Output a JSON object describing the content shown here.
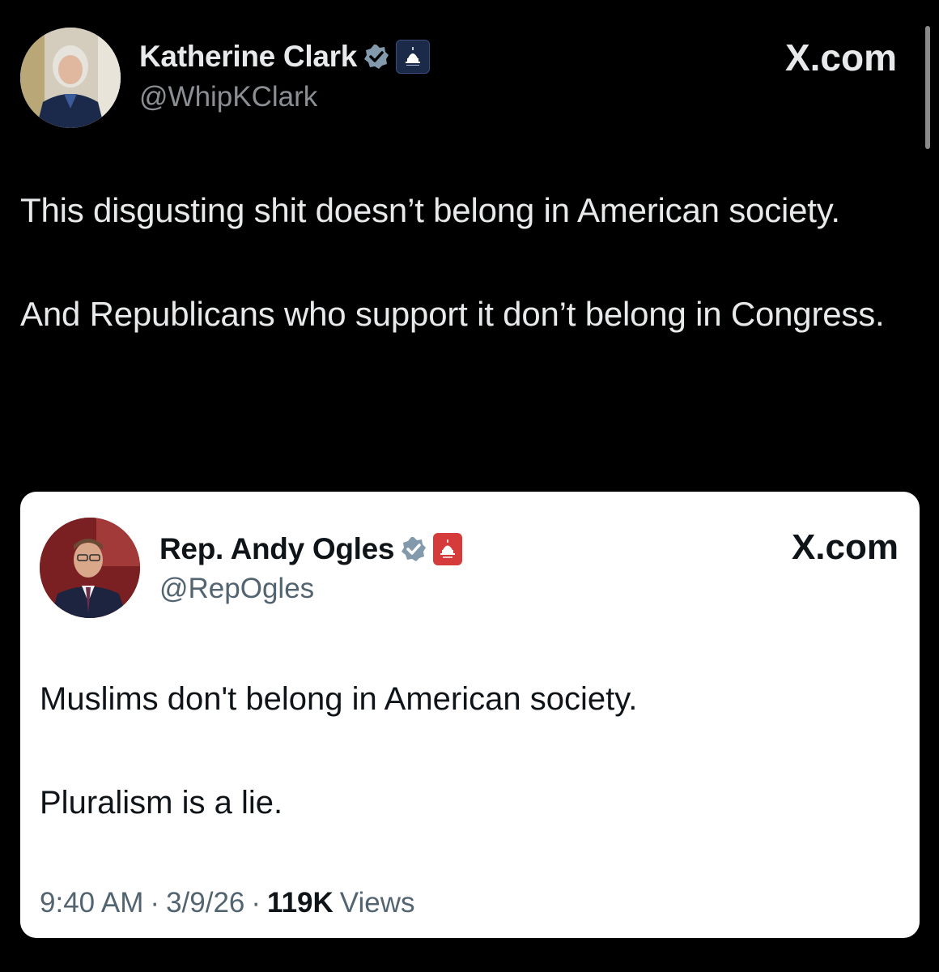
{
  "outer_tweet": {
    "author_name": "Katherine Clark",
    "handle": "@WhipKClark",
    "site_label": "X.com",
    "paragraphs": [
      "This disgusting shit doesn’t belong in American society.",
      "And Republicans who support it don’t belong in Congress."
    ],
    "verified_icon": "verified-badge-icon",
    "affiliation_icon": "capitol-dome-icon"
  },
  "quoted_tweet": {
    "author_name": "Rep. Andy Ogles",
    "handle": "@RepOgles",
    "site_label": "X.com",
    "paragraphs": [
      "Muslims don't belong in American society.",
      "Pluralism is a lie."
    ],
    "time": "9:40 AM",
    "date": "3/9/26",
    "separator": "·",
    "views_count": "119K",
    "views_label": "Views",
    "verified_icon": "verified-badge-icon",
    "affiliation_icon": "capitol-dome-icon"
  },
  "colors": {
    "background": "#000000",
    "card_background": "#ffffff",
    "verified_badge": "#829aab",
    "outer_affiliation_badge": "#1c2a4a",
    "quote_affiliation_badge": "#d63b3b",
    "secondary_text_dark": "#8b8f94",
    "secondary_text_light": "#536471"
  }
}
